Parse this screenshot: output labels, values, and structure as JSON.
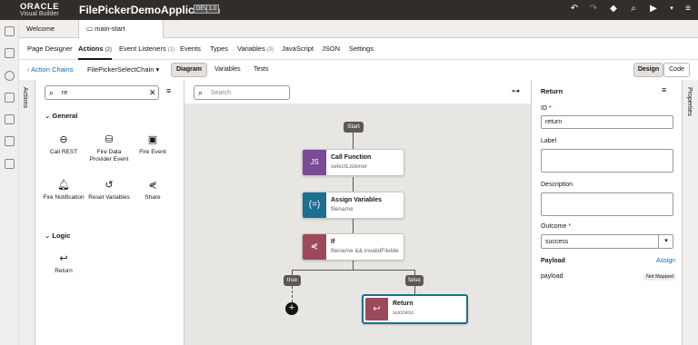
{
  "header": {
    "logo_line1": "ORACLE",
    "logo_line2": "Visual Builder",
    "app_title": "FilePickerDemoApplication",
    "badge_env": "DEV",
    "badge_version": "1.0"
  },
  "file_tabs": [
    {
      "label": "Welcome"
    },
    {
      "label": "main-start"
    }
  ],
  "subnav": [
    {
      "label": "Page Designer"
    },
    {
      "label": "Actions",
      "count": "(2)"
    },
    {
      "label": "Event Listeners",
      "count": "(1)"
    },
    {
      "label": "Events"
    },
    {
      "label": "Types"
    },
    {
      "label": "Variables",
      "count": "(3)"
    },
    {
      "label": "JavaScript"
    },
    {
      "label": "JSON"
    },
    {
      "label": "Settings"
    }
  ],
  "toolrow": {
    "back_link": "Action Chains",
    "chain_name": "FilePickerSelectChain",
    "tabs": [
      "Diagram",
      "Variables",
      "Tests"
    ],
    "view_design": "Design",
    "view_code": "Code"
  },
  "actions_rail_label": "Actions",
  "palette": {
    "search_value": "re",
    "section_general": "General",
    "general_items": [
      "Call REST",
      "Fire Data Provider Event",
      "Fire Event",
      "Fire Notification",
      "Reset Variables",
      "Share"
    ],
    "section_logic": "Logic",
    "logic_items": [
      "Return"
    ]
  },
  "canvas": {
    "search_placeholder": "Search",
    "start_label": "Start",
    "nodes": [
      {
        "title": "Call Function",
        "subtitle": "selectListener",
        "color": "#7b4a98"
      },
      {
        "title": "Assign Variables",
        "subtitle": "filename",
        "color": "#1d6f8f"
      },
      {
        "title": "If",
        "subtitle": "filename && invalidFileMe",
        "color": "#9c4a5a"
      },
      {
        "title": "Return",
        "subtitle": "success",
        "color": "#9c4a5a"
      }
    ],
    "branch_true": "true",
    "branch_false": "false"
  },
  "properties": {
    "title": "Return",
    "id_label": "ID",
    "id_value": "return",
    "label_label": "Label",
    "description_label": "Description",
    "outcome_label": "Outcome",
    "outcome_value": "success",
    "payload_label": "Payload",
    "assign_link": "Assign",
    "payload_row": "payload",
    "not_mapped": "Not Mapped",
    "rail_label": "Properties"
  },
  "colors": {
    "header_bg": "#312d2a",
    "accent_blue": "#1d6f8f",
    "link_blue": "#0f6ab4"
  }
}
